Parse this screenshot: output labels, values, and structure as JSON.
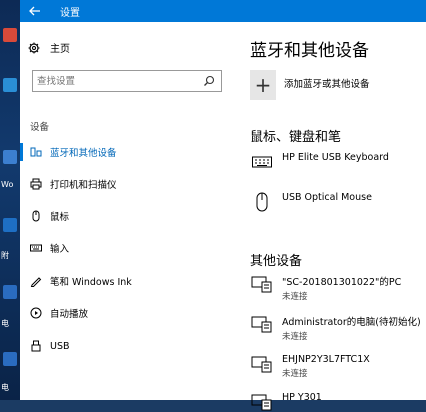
{
  "window": {
    "title": "设置"
  },
  "sidebar": {
    "home_label": "主页",
    "search_placeholder": "查找设置",
    "section_label": "设备",
    "items": [
      {
        "label": "蓝牙和其他设备",
        "icon": "bluetooth-devices-icon",
        "active": true
      },
      {
        "label": "打印机和扫描仪",
        "icon": "printer-icon",
        "active": false
      },
      {
        "label": "鼠标",
        "icon": "mouse-icon",
        "active": false
      },
      {
        "label": "输入",
        "icon": "keyboard-icon",
        "active": false
      },
      {
        "label": "笔和 Windows Ink",
        "icon": "pen-icon",
        "active": false
      },
      {
        "label": "自动播放",
        "icon": "autoplay-icon",
        "active": false
      },
      {
        "label": "USB",
        "icon": "usb-icon",
        "active": false
      }
    ]
  },
  "main": {
    "title": "蓝牙和其他设备",
    "add_label": "添加蓝牙或其他设备",
    "kbm_heading": "鼠标、键盘和笔",
    "kbm_devices": [
      {
        "name": "HP Elite USB Keyboard",
        "icon": "keyboard-icon"
      },
      {
        "name": "USB Optical Mouse",
        "icon": "mouse-icon"
      }
    ],
    "other_heading": "其他设备",
    "other_devices": [
      {
        "name": "\"SC-201801301022\"的PC",
        "status": "未连接",
        "icon": "pc-media-device-icon"
      },
      {
        "name": "Administrator的电脑(待初始化)",
        "status": "未连接",
        "icon": "pc-media-device-icon"
      },
      {
        "name": "EHJNP2Y3L7FTC1X",
        "status": "未连接",
        "icon": "pc-media-device-icon"
      },
      {
        "name": "HP Y301",
        "status": "",
        "icon": "pc-media-device-icon"
      }
    ]
  },
  "colors": {
    "accent": "#0078d7",
    "active_text": "#0067b8"
  }
}
